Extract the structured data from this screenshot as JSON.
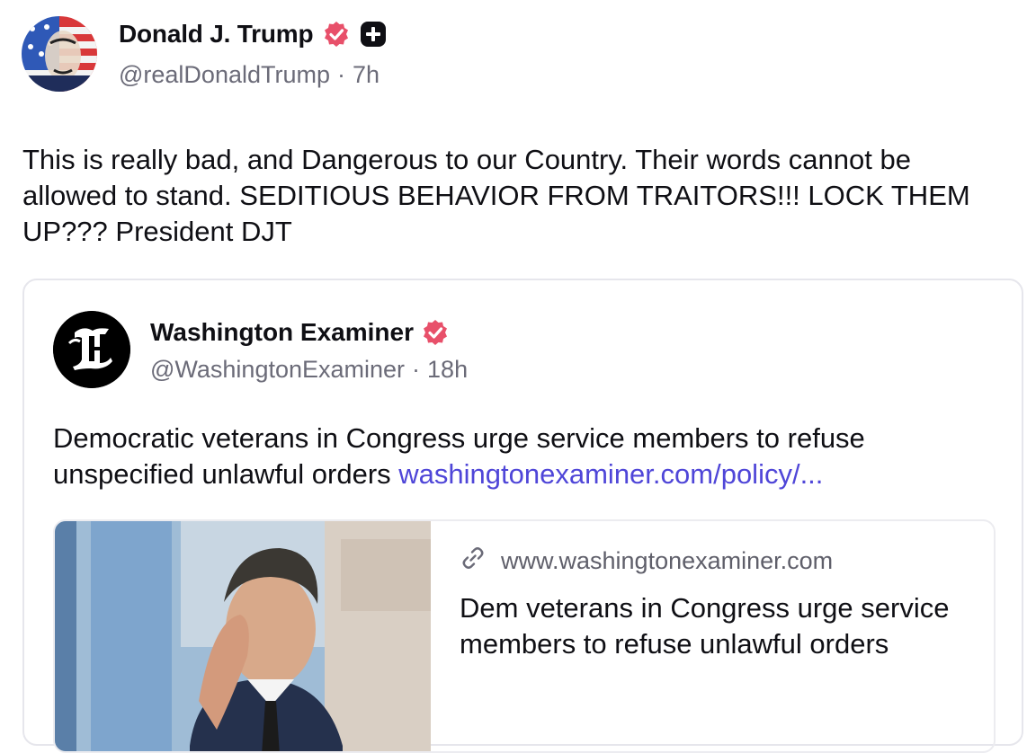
{
  "post": {
    "author_name": "Donald J. Trump",
    "handle": "@realDonaldTrump",
    "separator": "·",
    "time_ago": "7h",
    "text": "This is really bad, and Dangerous to our Country. Their words cannot be allowed to stand. SEDITIOUS BEHAVIOR FROM TRAITORS!!! LOCK THEM UP??? President DJT"
  },
  "quote": {
    "author_name": "Washington Examiner",
    "handle": "@WashingtonExaminer",
    "separator": "·",
    "time_ago": "18h",
    "text": "Democratic veterans in Congress urge service members to refuse unspecified unlawful orders",
    "link_text": "washingtonexaminer.com/policy/...",
    "card": {
      "domain": "www.washingtonexaminer.com",
      "title": "Dem veterans in Congress urge service members to refuse unlawful orders"
    }
  },
  "icons": {
    "verified": "verified-badge-icon",
    "plus": "plus-badge-icon",
    "link": "link-icon"
  },
  "colors": {
    "verified": "#e8506a",
    "link": "#4f46d8",
    "muted": "#6b6b78"
  }
}
